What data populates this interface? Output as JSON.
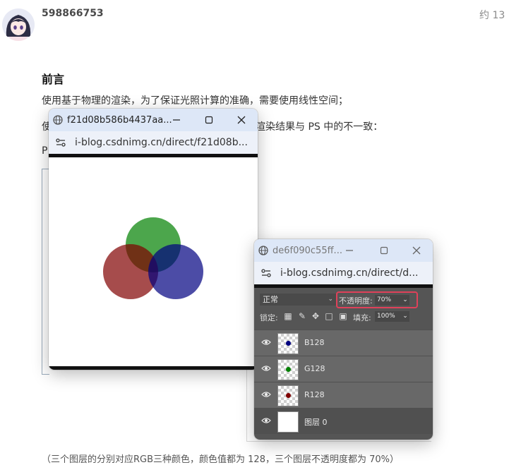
{
  "article": {
    "author": "598866753",
    "date": "约 13 ",
    "heading": "前言",
    "para1": "使用基于物理的渲染，为了保证光照计算的准确，需要使用线性空间；",
    "para2_start": "使",
    "para2_end": "中的渲染结果与 PS 中的不一致：",
    "para3_start": "P",
    "bottom_text": "（三个图层的分别对应RGB三种颜色，颜色值都为 128，三个图层不透明度都为 70%）"
  },
  "popup1": {
    "title": "f21d08b586b4437aa...",
    "url": "i-blog.csdnimg.cn/direct/f21d08b...",
    "circles": [
      {
        "name": "green-circle",
        "color": "#008000"
      },
      {
        "name": "red-circle",
        "color": "#800000"
      },
      {
        "name": "blue-circle",
        "color": "#000080"
      }
    ],
    "opacity": 0.7
  },
  "popup2": {
    "title": "de6f090c55ff...",
    "url": "i-blog.csdnimg.cn/direct/d...",
    "ps": {
      "blend_mode": "正常",
      "opacity_label": "不透明度:",
      "opacity_value": "70%",
      "lock_label": "锁定:",
      "fill_label": "填充:",
      "fill_value": "100%",
      "layers": [
        {
          "name": "B128",
          "dot_color": "#000080"
        },
        {
          "name": "G128",
          "dot_color": "#008000"
        },
        {
          "name": "R128",
          "dot_color": "#800000"
        },
        {
          "name": "图层 0",
          "dot_color": ""
        }
      ]
    }
  }
}
